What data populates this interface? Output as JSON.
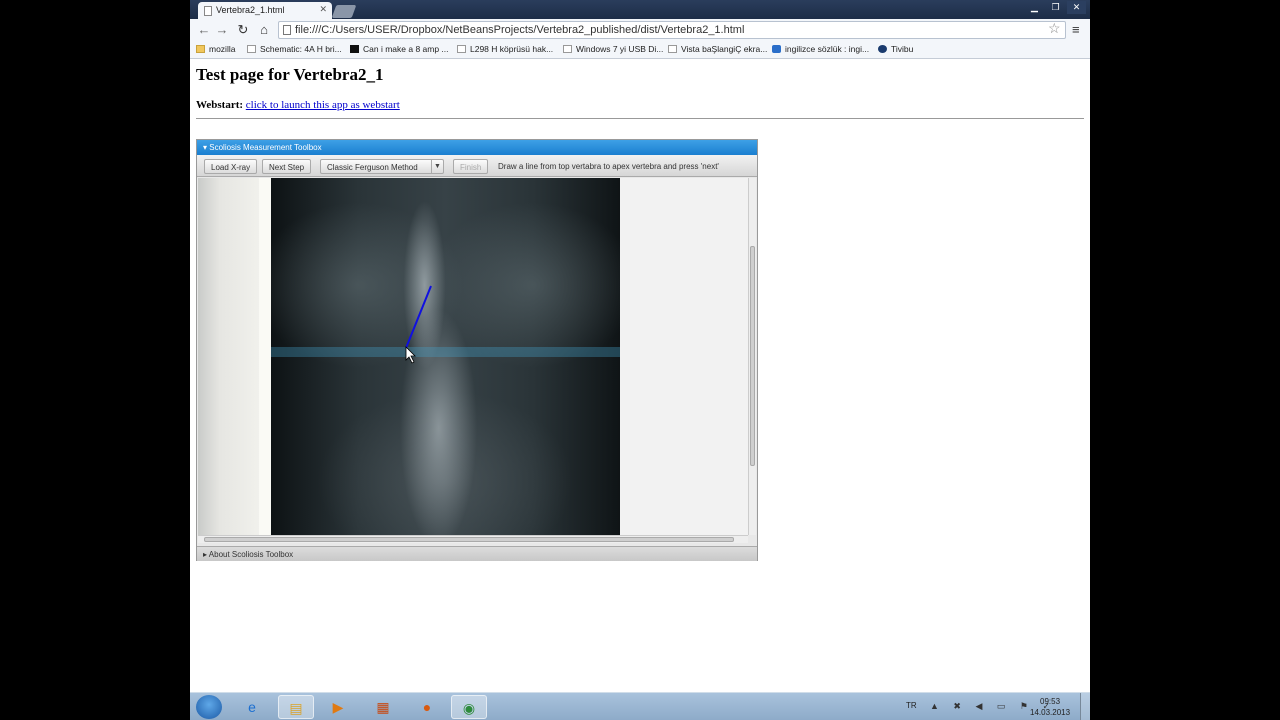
{
  "browser": {
    "tab_title": "Vertebra2_1.html",
    "address": "file:///C:/Users/USER/Dropbox/NetBeansProjects/Vertebra2_published/dist/Vertebra2_1.html",
    "bookmarks": [
      {
        "label": "mozilla",
        "icon": "folder-icon"
      },
      {
        "label": "Schematic: 4A H bri...",
        "icon": "page-icon"
      },
      {
        "label": "Can i make a 8 amp ...",
        "icon": "site-icon"
      },
      {
        "label": "L298 H köprüsü hak...",
        "icon": "page-icon"
      },
      {
        "label": "Windows 7 yi USB Di...",
        "icon": "page-icon"
      },
      {
        "label": "Vista baŞlangiÇ ekra...",
        "icon": "page-icon"
      },
      {
        "label": "ingilizce sözlük : ingi...",
        "icon": "s-icon"
      },
      {
        "label": "Tivibu",
        "icon": "tivibu-icon"
      }
    ]
  },
  "page": {
    "title": "Test page for Vertebra2_1",
    "webstart_label": "Webstart:",
    "webstart_link": "click to launch this app as webstart"
  },
  "applet": {
    "header": "Scoliosis Measurement Toolbox",
    "load_button": "Load X-ray",
    "next_button": "Next Step",
    "method_select": "Classic Ferguson Method",
    "finish_button": "Finish",
    "instruction": "Draw a line from top vertabra to apex vertebra and press 'next'",
    "footer": "About Scoliosis Toolbox"
  },
  "taskbar": {
    "language": "TR",
    "time": "09:53",
    "date": "14.03.2013"
  },
  "colors": {
    "applet_header": "#1a7fd0",
    "drawn_line": "#1010e0",
    "link": "#0000cc"
  }
}
